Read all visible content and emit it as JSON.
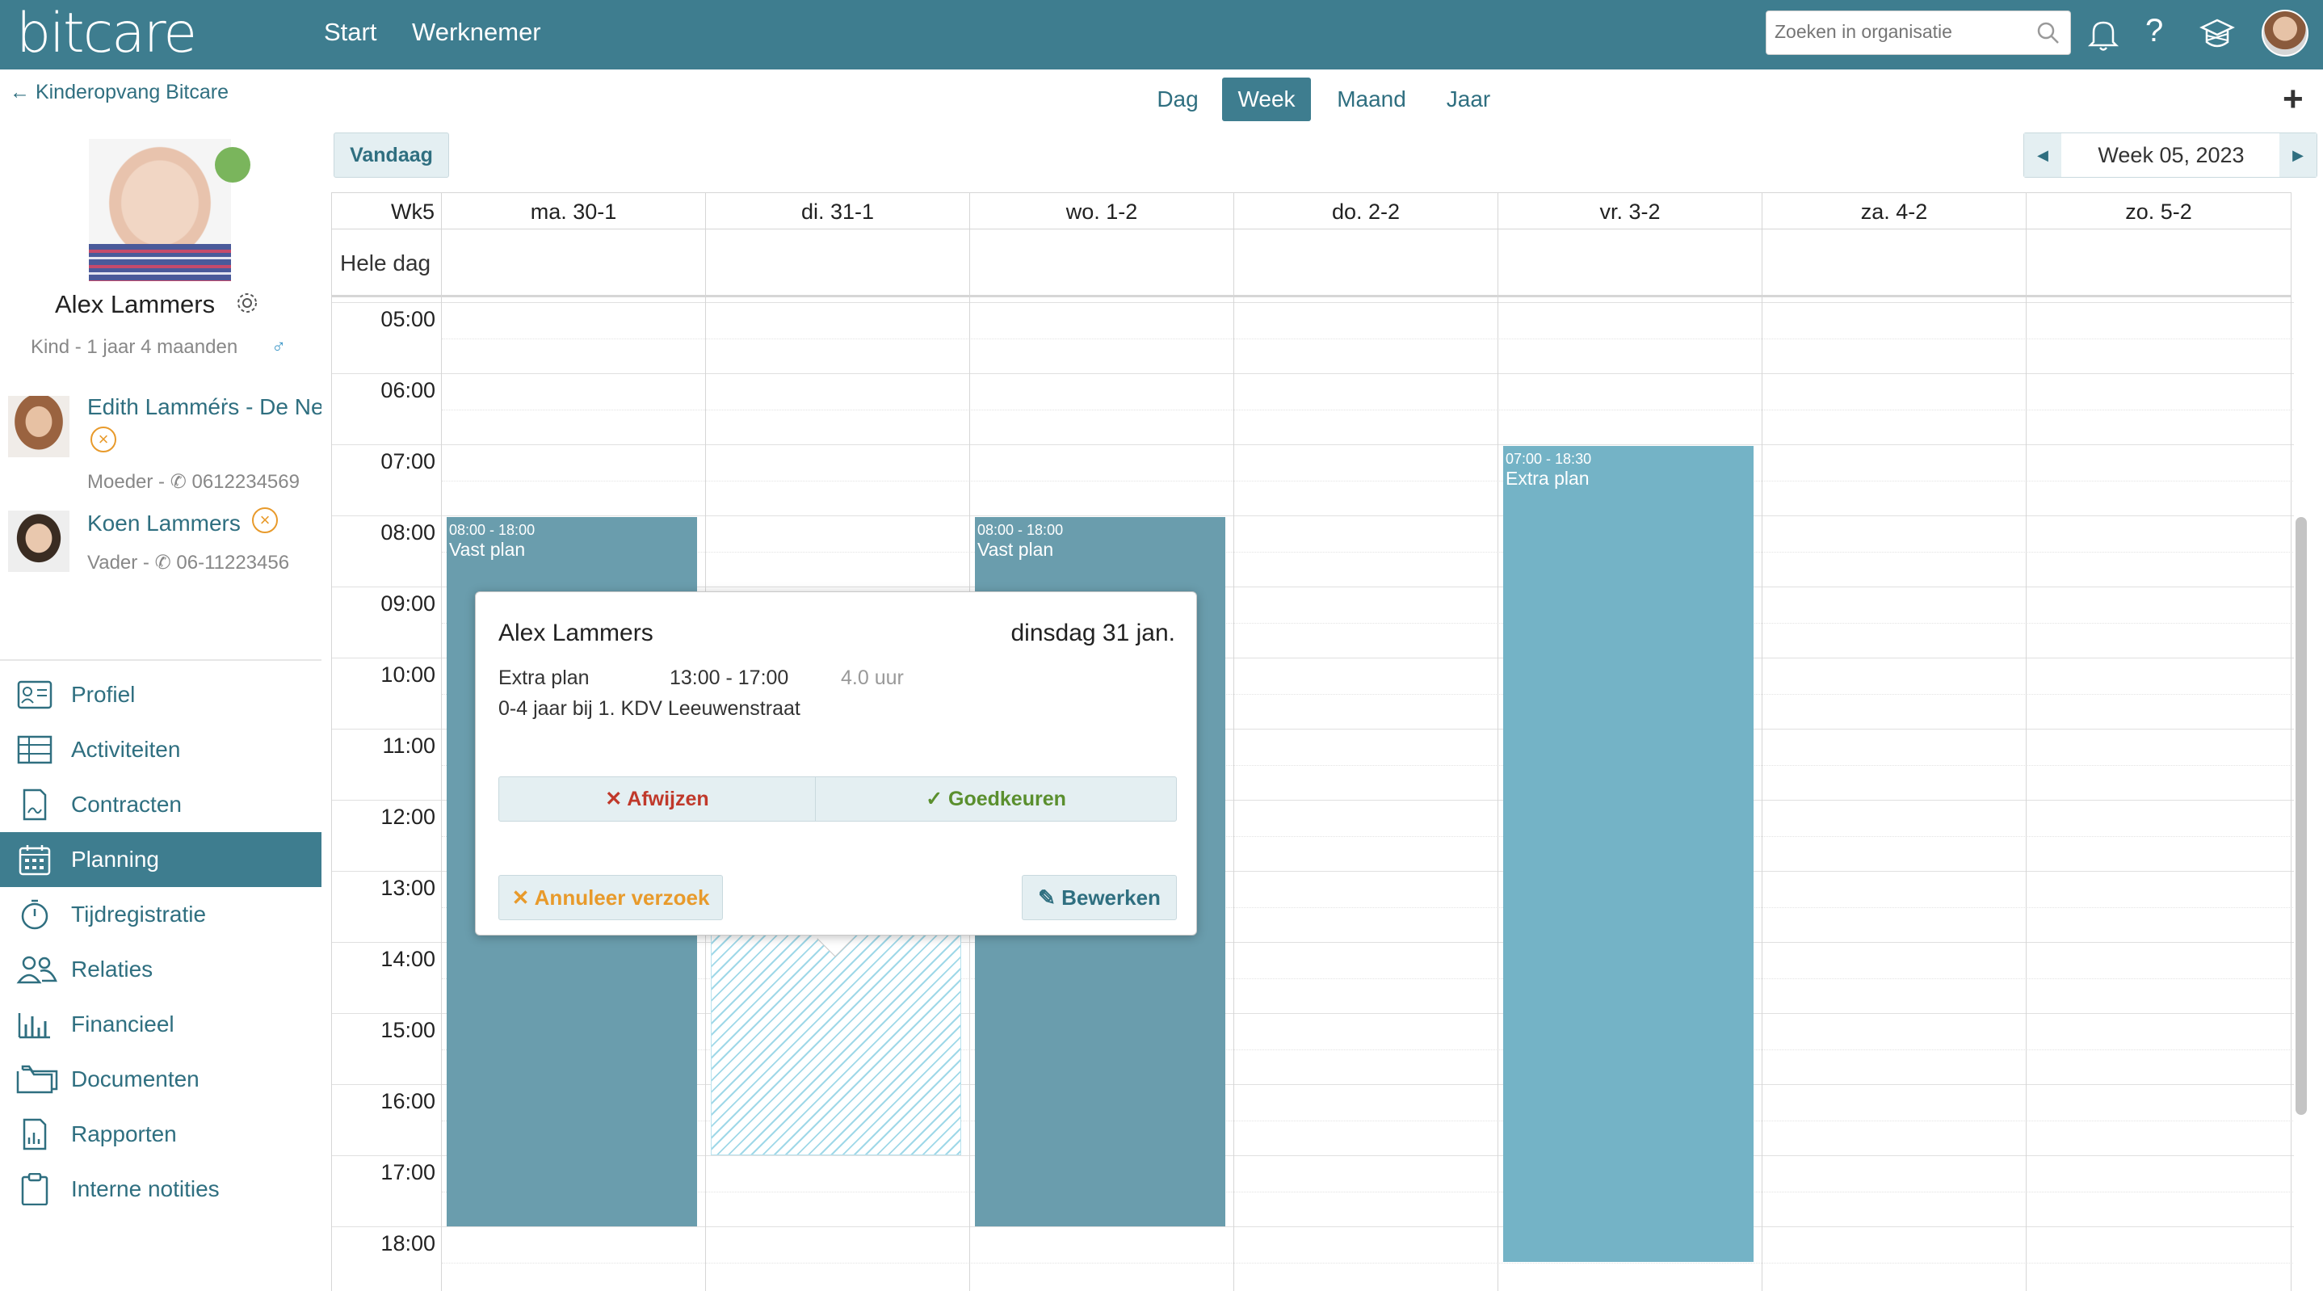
{
  "app": {
    "logo": "bitcare",
    "nav": [
      "Start",
      "Werknemer"
    ]
  },
  "search": {
    "placeholder": "Zoeken in organisatie"
  },
  "sidebar": {
    "back_label": "Kinderopvang Bitcare",
    "child": {
      "name": "Alex Lammers",
      "subtitle": "Kind - 1 jaar 4 maanden",
      "gender_symbol": "♂"
    },
    "relations": [
      {
        "name": "Edith Lamméṙs - De Ne",
        "role": "Moeder - ",
        "phone": "0612234569"
      },
      {
        "name": "Koen Lammers",
        "role": "Vader - ",
        "phone": "06-11223456"
      }
    ],
    "menu": [
      {
        "label": "Profiel",
        "icon": "profile-card-icon"
      },
      {
        "label": "Activiteiten",
        "icon": "table-icon"
      },
      {
        "label": "Contracten",
        "icon": "contract-icon"
      },
      {
        "label": "Planning",
        "icon": "calendar-icon"
      },
      {
        "label": "Tijdregistratie",
        "icon": "stopwatch-icon"
      },
      {
        "label": "Relaties",
        "icon": "people-icon"
      },
      {
        "label": "Financieel",
        "icon": "bar-chart-icon"
      },
      {
        "label": "Documenten",
        "icon": "folder-icon"
      },
      {
        "label": "Rapporten",
        "icon": "report-icon"
      },
      {
        "label": "Interne notities",
        "icon": "clipboard-icon"
      }
    ],
    "active_menu": "Planning"
  },
  "views": {
    "tabs": [
      "Dag",
      "Week",
      "Maand",
      "Jaar"
    ],
    "active": "Week"
  },
  "toolbar": {
    "today_label": "Vandaag",
    "week_label": "Week 05, 2023"
  },
  "calendar": {
    "week_col": "Wk5",
    "allday_label": "Hele dag",
    "days": [
      "ma. 30-1",
      "di. 31-1",
      "wo. 1-2",
      "do. 2-2",
      "vr. 3-2",
      "za. 4-2",
      "zo. 5-2"
    ],
    "hours": [
      "05:00",
      "06:00",
      "07:00",
      "08:00",
      "09:00",
      "10:00",
      "11:00",
      "12:00",
      "13:00",
      "14:00",
      "15:00",
      "16:00",
      "17:00",
      "18:00"
    ],
    "events": [
      {
        "time": "08:00 - 18:00",
        "title": "Vast plan",
        "color": "#6a9dad"
      },
      {
        "time": "08:00 - 18:00",
        "title": "Vast plan",
        "color": "#6a9dad"
      },
      {
        "time": "07:00 - 18:30",
        "title": "Extra plan",
        "color": "#74b3c6"
      }
    ]
  },
  "popup": {
    "name": "Alex Lammers",
    "date": "dinsdag 31 jan.",
    "type": "Extra plan",
    "time": "13:00 - 17:00",
    "hours": "4.0 uur",
    "location": "0-4 jaar bij 1. KDV Leeuwenstraat",
    "reject_label": "Afwijzen",
    "approve_label": "Goedkeuren",
    "cancel_label": "Annuleer verzoek",
    "edit_label": "Bewerken",
    "colors": {
      "reject": "#c0392b",
      "approve": "#5a8f2e",
      "cancel": "#e89a2b"
    }
  }
}
